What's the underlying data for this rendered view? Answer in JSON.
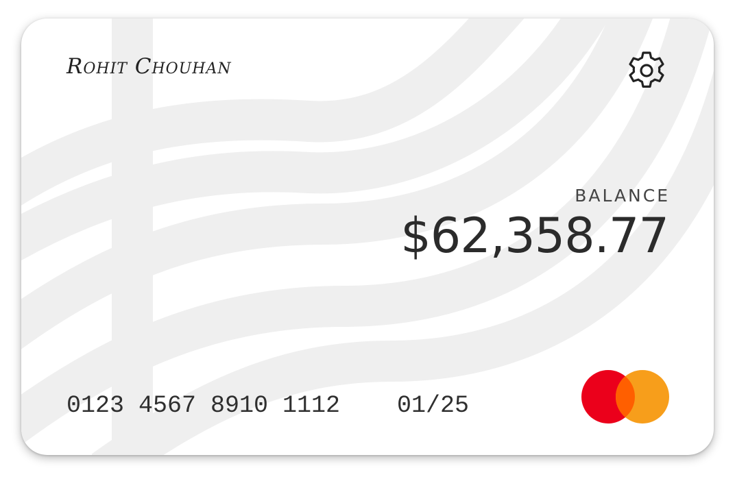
{
  "card": {
    "holder_name": "Rohit Chouhan",
    "balance_label": "BALANCE",
    "balance_amount": "$62,358.77",
    "number_groups": [
      "0123",
      "4567",
      "8910",
      "1112"
    ],
    "expiry": "01/25",
    "network": "mastercard-logo",
    "settings_icon": "gear-icon"
  },
  "colors": {
    "card_background": "#ffffff",
    "wave_pattern": "#efefef",
    "text_dark": "#2b2b2b",
    "network_red": "#eb001b",
    "network_orange": "#f79e1b",
    "network_overlap": "#ff5f00"
  }
}
